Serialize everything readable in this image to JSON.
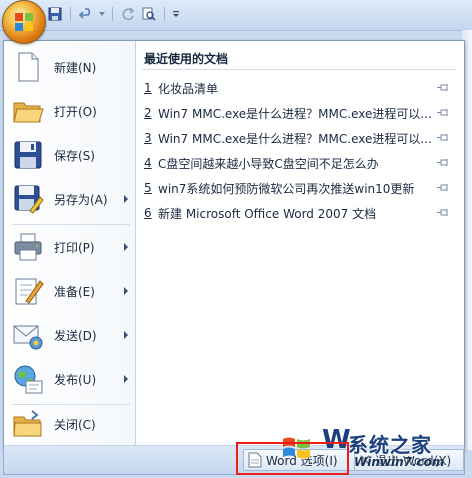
{
  "menu": {
    "items": [
      {
        "label": "新建(N)",
        "icon": "new-document-icon",
        "submenu": false
      },
      {
        "label": "打开(O)",
        "icon": "open-folder-icon",
        "submenu": false
      },
      {
        "label": "保存(S)",
        "icon": "save-disk-icon",
        "submenu": false
      },
      {
        "label": "另存为(A)",
        "icon": "save-as-icon",
        "submenu": true
      },
      {
        "label": "打印(P)",
        "icon": "printer-icon",
        "submenu": true
      },
      {
        "label": "准备(E)",
        "icon": "prepare-pen-icon",
        "submenu": true
      },
      {
        "label": "发送(D)",
        "icon": "send-envelope-icon",
        "submenu": true
      },
      {
        "label": "发布(U)",
        "icon": "publish-globe-icon",
        "submenu": true
      },
      {
        "label": "关闭(C)",
        "icon": "close-folder-icon",
        "submenu": false
      }
    ]
  },
  "recent": {
    "title": "最近使用的文档",
    "docs": [
      {
        "num": "1",
        "name": "化妆品清单"
      },
      {
        "num": "2",
        "name": "Win7 MMC.exe是什么进程？MMC.exe进程可以..."
      },
      {
        "num": "3",
        "name": "Win7 MMC.exe是什么进程？MMC.exe进程可以..."
      },
      {
        "num": "4",
        "name": "C盘空间越来越小导致C盘空间不足怎么办"
      },
      {
        "num": "5",
        "name": "win7系统如何预防微软公司再次推送win10更新"
      },
      {
        "num": "6",
        "name": "新建 Microsoft Office Word 2007 文档"
      }
    ]
  },
  "bottom": {
    "options_label": "Word 选项(I)",
    "exit_label": "退出 Word(X)"
  },
  "watermark": {
    "brand": "系统之家",
    "site": "Winwin7.com",
    "letter": "W"
  },
  "colors": {
    "highlight": "#ef1c1c",
    "orb": "#e07a12"
  }
}
